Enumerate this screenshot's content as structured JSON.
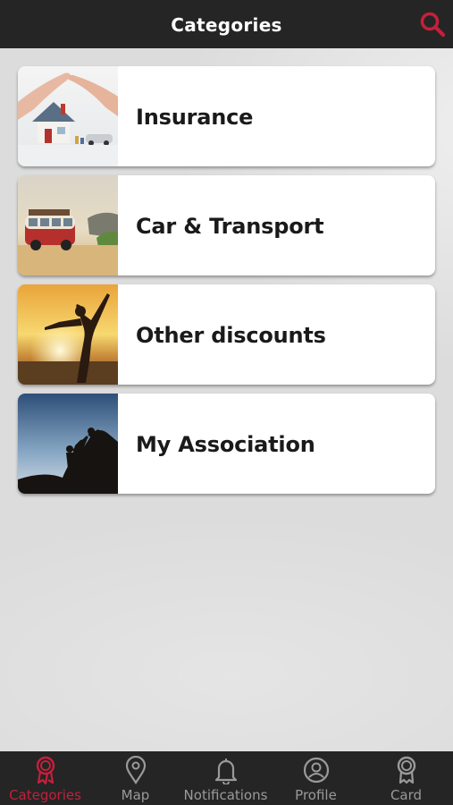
{
  "header": {
    "title": "Categories",
    "search_icon": "search-icon"
  },
  "categories": [
    {
      "label": "Insurance",
      "image": "house-in-hands-photo"
    },
    {
      "label": "Car & Transport",
      "image": "camper-van-beach-photo"
    },
    {
      "label": "Other discounts",
      "image": "woman-sunset-beach-photo"
    },
    {
      "label": "My Association",
      "image": "climbers-helping-photo"
    }
  ],
  "tabs": [
    {
      "label": "Categories",
      "icon": "ribbon-badge-icon",
      "active": true
    },
    {
      "label": "Map",
      "icon": "map-pin-icon",
      "active": false
    },
    {
      "label": "Notifications",
      "icon": "bell-icon",
      "active": false
    },
    {
      "label": "Profile",
      "icon": "user-circle-icon",
      "active": false
    },
    {
      "label": "Card",
      "icon": "award-card-icon",
      "active": false
    }
  ],
  "colors": {
    "accent": "#c4203b",
    "bar": "#252525",
    "inactive_tab": "#9a9a9a"
  }
}
